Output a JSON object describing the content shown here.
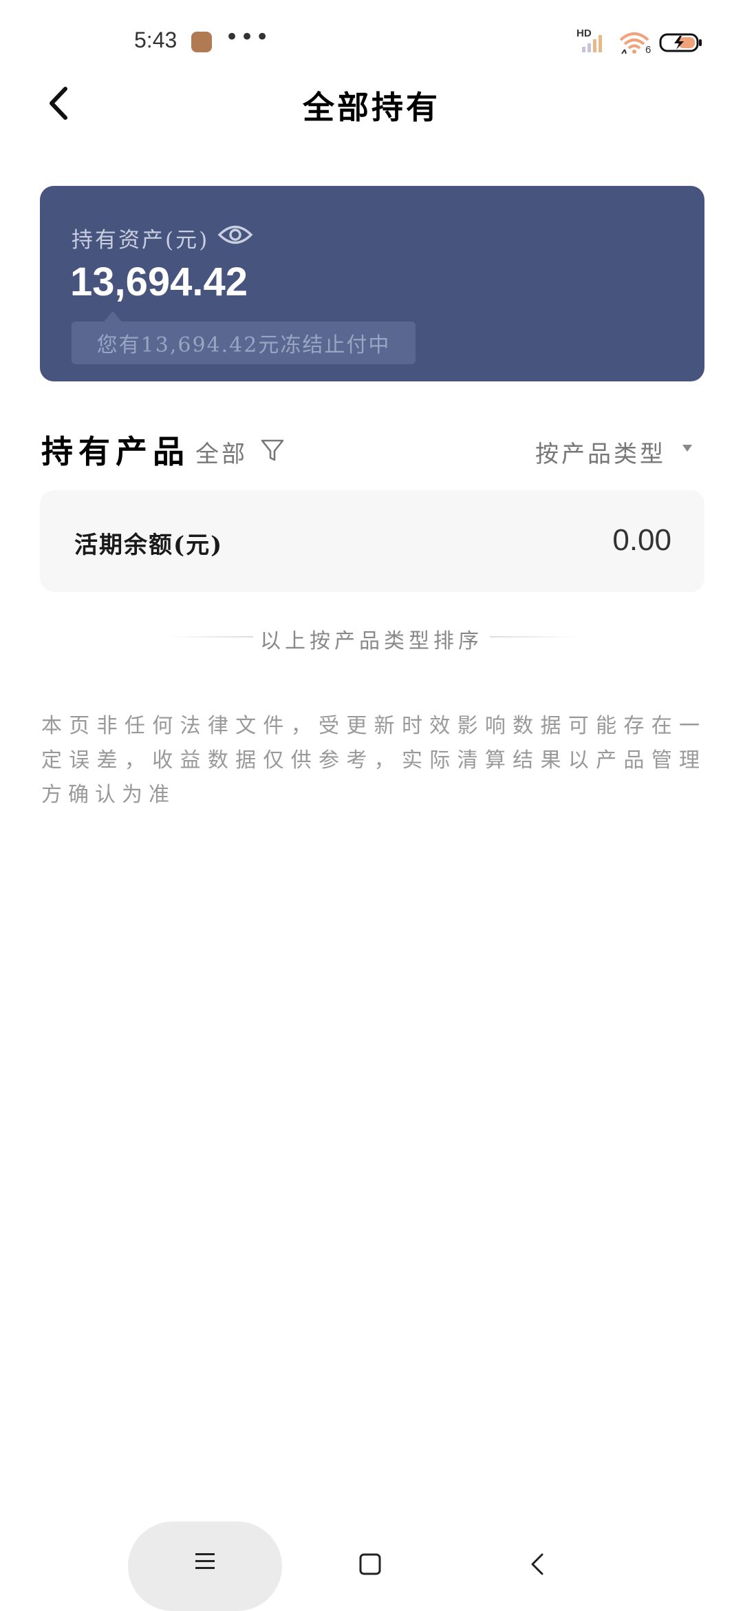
{
  "status_bar": {
    "time": "5:43",
    "dots": "•••",
    "network_label": "HD",
    "wifi_label": "6",
    "icons": [
      "app-notification-icon",
      "signal-icon",
      "wifi-icon",
      "battery-charging-icon"
    ]
  },
  "header": {
    "title": "全部持有",
    "back_icon": "chevron-left-icon"
  },
  "asset_card": {
    "label": "持有资产(元)",
    "amount": "13,694.42",
    "frozen_note": "您有13,694.42元冻结止付中",
    "visibility_icon": "eye-icon",
    "background_color": "#46547e"
  },
  "holdings": {
    "title": "持有产品",
    "filter_label": "全部",
    "filter_icon": "funnel-icon",
    "sort_label": "按产品类型",
    "sort_icon": "caret-down-icon",
    "items": [
      {
        "label": "活期余额(元)",
        "value": "0.00"
      }
    ],
    "sort_caption": "以上按产品类型排序"
  },
  "disclaimer": "本页非任何法律文件，受更新时效影响数据可能存在一定误差，收益数据仅供参考，实际清算结果以产品管理方确认为准",
  "nav_bar": {
    "icons": [
      "menu-icon",
      "home-square-icon",
      "back-chevron-icon"
    ]
  }
}
